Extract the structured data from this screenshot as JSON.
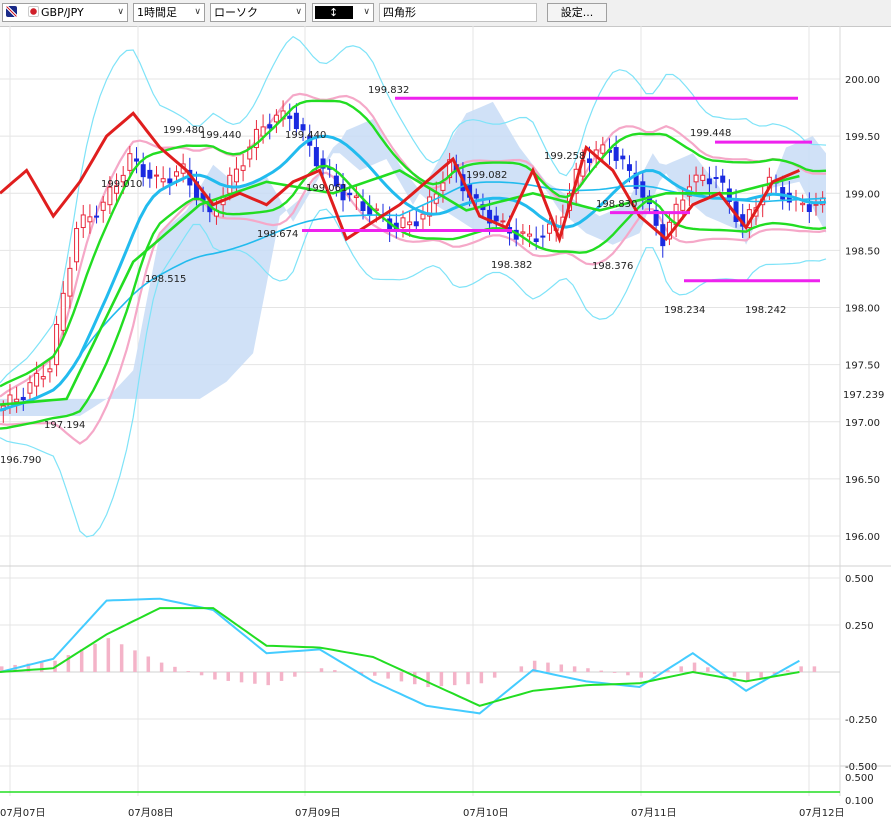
{
  "toolbar": {
    "symbol": "GBP/JPY",
    "timeframe": "1時間足",
    "chart_style": "ローソク",
    "draw_tool_icon": "dark-block-icon",
    "draw_shape": "四角形",
    "settings_label": "設定..."
  },
  "price_axis": {
    "labels": [
      "200.00",
      "199.50",
      "199.00",
      "198.50",
      "198.00",
      "197.50",
      "197.00",
      "196.50",
      "196.00"
    ],
    "current_label": "197.239"
  },
  "macd_axis": {
    "labels": [
      "0.500",
      "0.250",
      "-0.250",
      "-0.500"
    ]
  },
  "sub_axis": {
    "labels": [
      "0.500",
      "0.100"
    ]
  },
  "time_axis": {
    "labels": [
      "07月07日",
      "07月08日",
      "07月09日",
      "07月10日",
      "07月11日",
      "07月12日"
    ]
  },
  "price_annotations": [
    "196.790",
    "197.194",
    "199.010",
    "198.515",
    "199.480",
    "199.440",
    "198.674",
    "199.440",
    "199.061",
    "199.832",
    "199.082",
    "198.382",
    "199.258",
    "198.830",
    "198.376",
    "199.448",
    "198.234",
    "198.242"
  ],
  "colors": {
    "candle_up": "#e8283c",
    "candle_down": "#1a2ae0",
    "red_line": "#e01e1e",
    "green_line": "#22dd22",
    "sky_line": "#22bbee",
    "pink_band": "#f5a8c8",
    "cyan_band": "#7fe3f8",
    "cloud": "#c8dcf6",
    "magenta": "#ee22ee",
    "hist": "#f4b3c8"
  },
  "chart_data": {
    "type": "line",
    "instrument": "GBP/JPY",
    "timeframe": "1時間足",
    "y_range": [
      195.83,
      200.35
    ],
    "x_days": [
      "07月07日",
      "07月08日",
      "07月09日",
      "07月10日",
      "07月11日",
      "07月12日"
    ],
    "marked_levels": [
      199.832,
      198.674,
      199.448,
      198.83,
      198.234
    ],
    "series": [
      {
        "name": "close",
        "kind": "candles",
        "x": [
          0,
          4,
          8,
          12,
          16,
          20,
          24,
          28,
          32,
          36,
          40,
          44,
          48,
          52,
          56,
          60,
          64,
          68,
          72,
          76,
          80,
          84,
          88,
          92,
          96,
          100,
          104,
          108,
          112,
          116,
          120
        ],
        "values": [
          197.1,
          197.25,
          197.5,
          198.7,
          198.9,
          199.3,
          199.1,
          199.2,
          198.8,
          199.2,
          199.6,
          199.7,
          199.3,
          199.0,
          198.85,
          198.7,
          198.8,
          199.25,
          198.9,
          198.7,
          198.6,
          198.7,
          199.3,
          199.4,
          199.1,
          198.6,
          199.1,
          199.15,
          198.7,
          199.1,
          198.9
        ]
      },
      {
        "name": "",
        "kind": "line",
        "x": [
          0,
          4,
          8,
          12,
          16,
          20,
          24,
          28,
          32,
          36,
          40,
          44,
          48,
          52,
          56,
          60,
          64,
          68,
          72,
          76,
          80,
          84,
          88,
          92,
          96,
          100,
          104,
          108,
          112,
          116,
          120
        ],
        "values": [
          199.0,
          199.2,
          198.8,
          199.1,
          199.5,
          199.7,
          199.4,
          199.2,
          198.9,
          199.0,
          198.9,
          199.1,
          199.2,
          198.6,
          198.75,
          198.9,
          199.1,
          199.3,
          198.8,
          198.7,
          199.2,
          198.6,
          199.4,
          199.2,
          198.8,
          198.6,
          198.9,
          199.0,
          198.7,
          199.1,
          199.2
        ]
      },
      {
        "name": "",
        "kind": "line",
        "x": [
          0,
          10,
          20,
          30,
          40,
          50,
          60,
          70,
          80,
          90,
          100,
          110,
          120
        ],
        "values": [
          197.15,
          197.2,
          198.4,
          198.9,
          199.1,
          199.0,
          199.2,
          198.85,
          199.0,
          198.85,
          199.0,
          199.0,
          199.15
        ]
      }
    ],
    "macd": {
      "y_range": [
        -0.5,
        0.5
      ],
      "x": [
        0,
        8,
        16,
        24,
        32,
        40,
        48,
        56,
        64,
        72,
        80,
        88,
        96,
        104,
        112,
        120
      ],
      "histogram": [
        0.03,
        0.06,
        0.18,
        0.05,
        -0.04,
        -0.07,
        0.02,
        -0.02,
        -0.08,
        -0.06,
        0.06,
        0.02,
        -0.03,
        0.05,
        -0.05,
        0.03
      ],
      "line_a": [
        0.0,
        0.07,
        0.38,
        0.39,
        0.33,
        0.1,
        0.12,
        -0.05,
        -0.18,
        -0.22,
        0.01,
        -0.05,
        -0.08,
        0.1,
        -0.1,
        0.06
      ],
      "line_b": [
        0.0,
        0.02,
        0.2,
        0.34,
        0.34,
        0.14,
        0.13,
        0.08,
        -0.05,
        -0.18,
        -0.1,
        -0.07,
        -0.06,
        0.0,
        -0.05,
        0.0
      ]
    }
  }
}
